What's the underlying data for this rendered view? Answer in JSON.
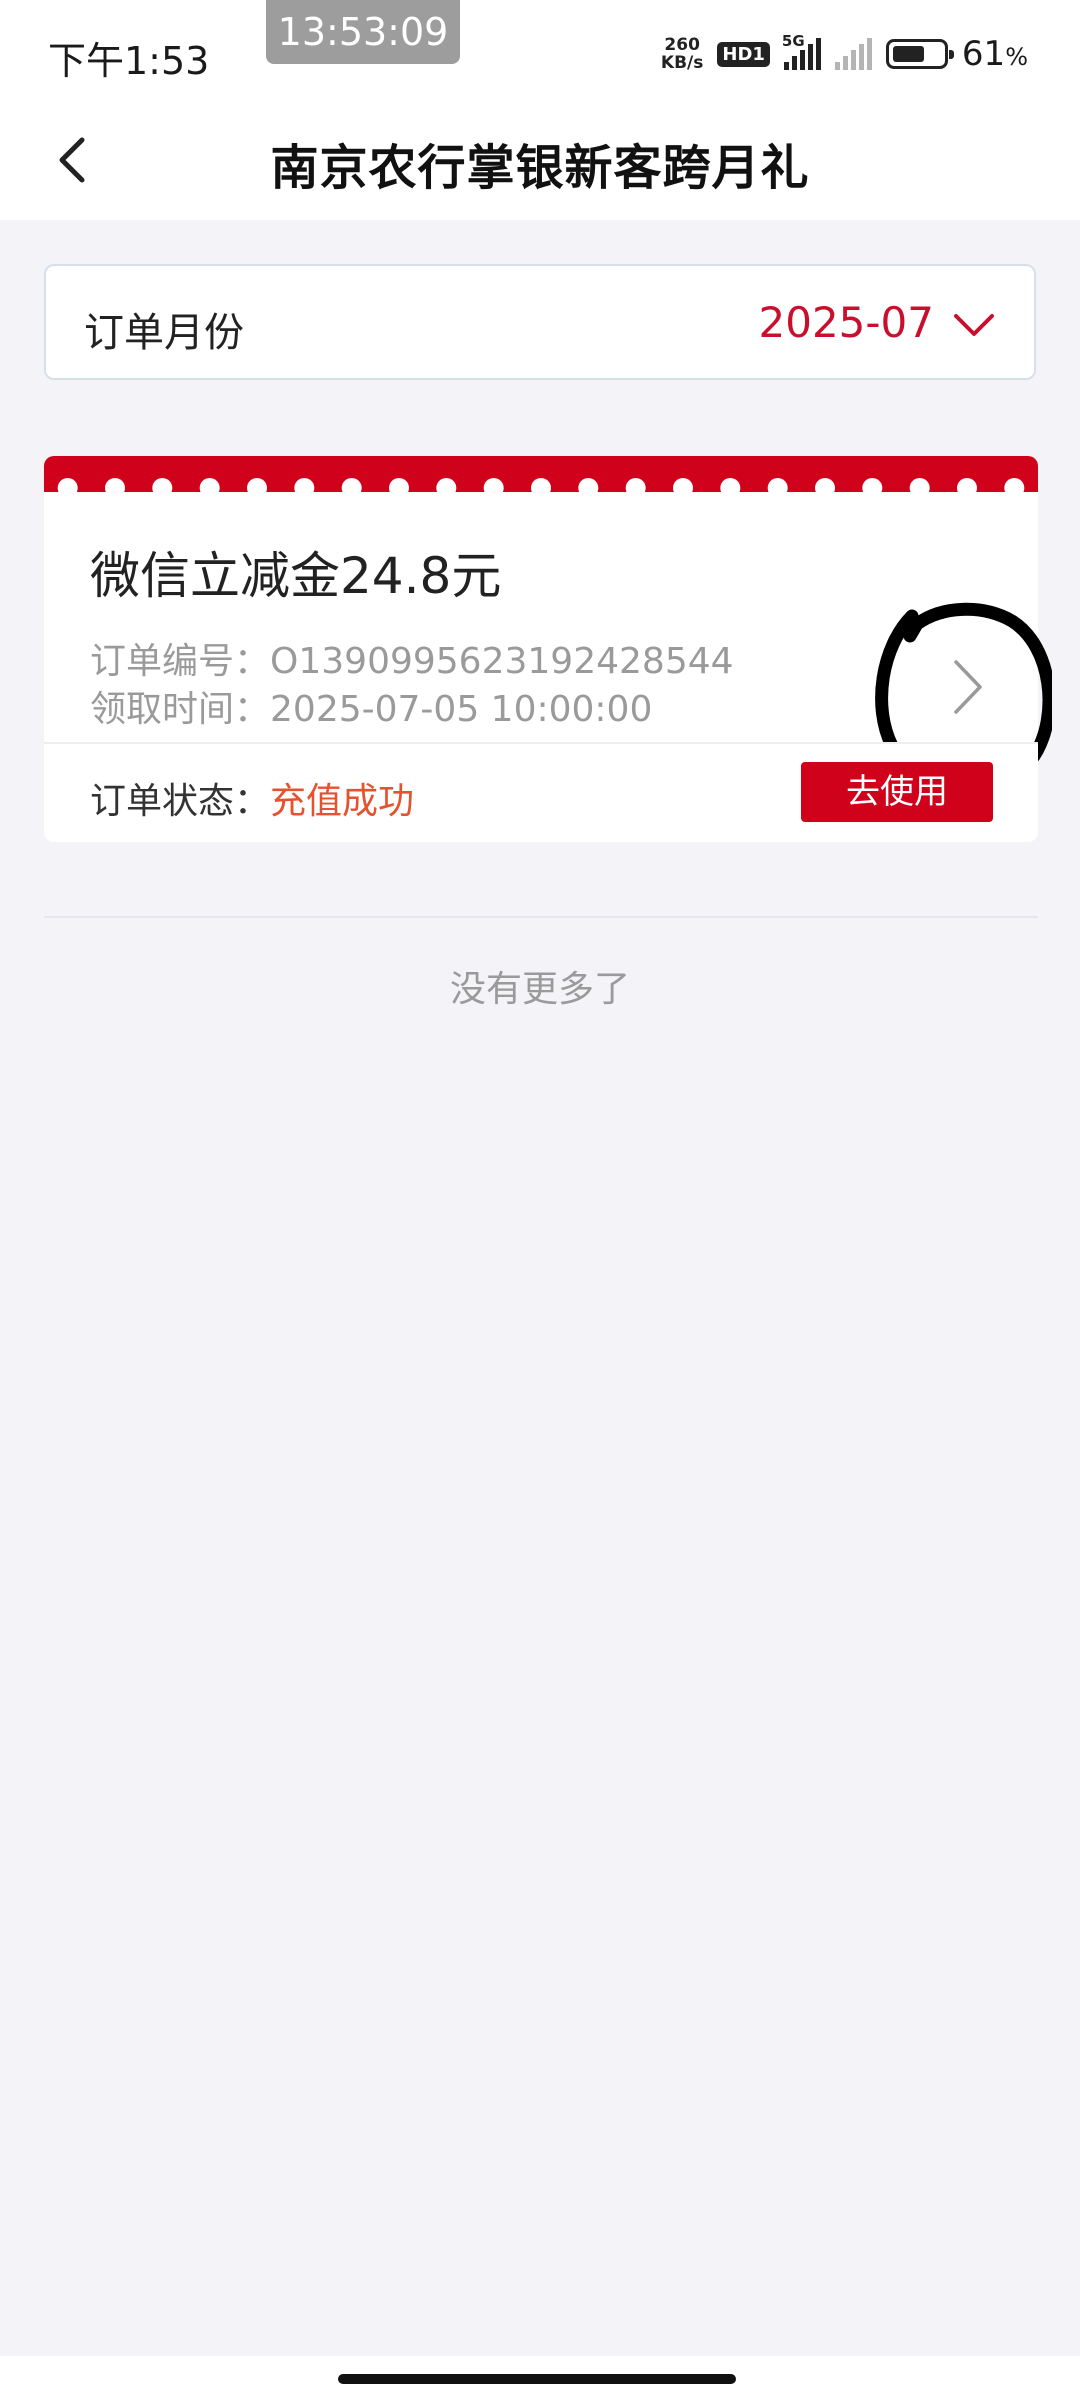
{
  "status_bar": {
    "time": "下午1:53",
    "clock_badge": "13:53:09",
    "net_speed_value": "260",
    "net_speed_unit": "KB/s",
    "hd_badge": "HD1",
    "network_type": "5G",
    "battery_percent": "61",
    "battery_symbol": "%",
    "battery_level": 0.61
  },
  "navbar": {
    "title": "南京农行掌银新客跨月礼"
  },
  "month_selector": {
    "label": "订单月份",
    "value": "2025-07"
  },
  "order": {
    "title": "微信立减金24.8元",
    "order_no_label": "订单编号：",
    "order_no": "O1390995623192428544",
    "time_label": "领取时间：",
    "time": "2025-07-05 10:00:00",
    "status_label": "订单状态：",
    "status": "充值成功",
    "use_button": "去使用"
  },
  "list_end_text": "没有更多了",
  "colors": {
    "accent_red": "#d0021b",
    "month_red": "#c8102e",
    "status_orange": "#e5522e",
    "background": "#f3f3f8"
  }
}
